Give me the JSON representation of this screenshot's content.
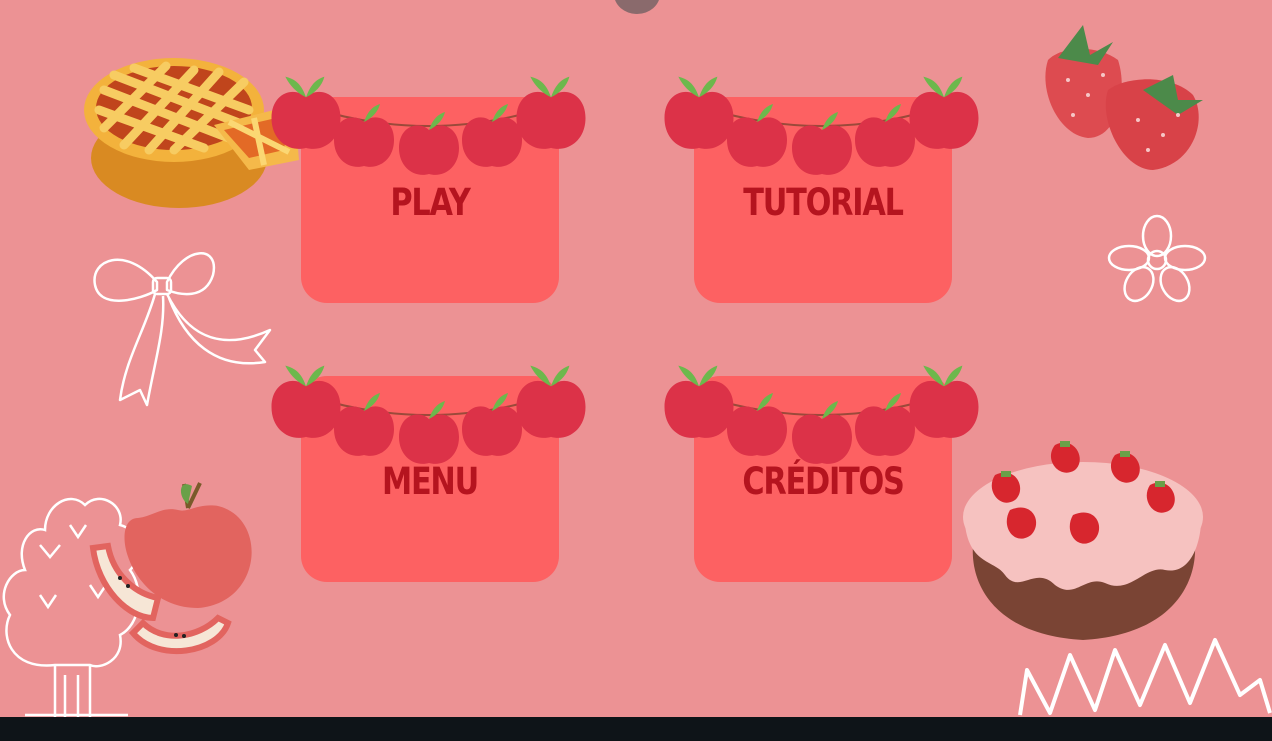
{
  "menu": {
    "buttons": [
      {
        "id": "play",
        "label": "PLAY"
      },
      {
        "id": "tutorial",
        "label": "TUTORIAL"
      },
      {
        "id": "menu",
        "label": "MENU"
      },
      {
        "id": "creditos",
        "label": "CRÉDITOS"
      }
    ]
  },
  "colors": {
    "background": "#ec9294",
    "card": "#fd6162",
    "label": "#b5141f",
    "apple": "#dc3248",
    "leaf": "#6cb84c",
    "bottom_bar": "#0e1418"
  },
  "decorations": [
    "apple-pie-icon",
    "strawberries-icon",
    "ribbon-bow-icon",
    "flower-icon",
    "apple-tree-icon",
    "apple-icon",
    "strawberry-cake-icon",
    "scribble-icon",
    "apple-garland-icon"
  ]
}
